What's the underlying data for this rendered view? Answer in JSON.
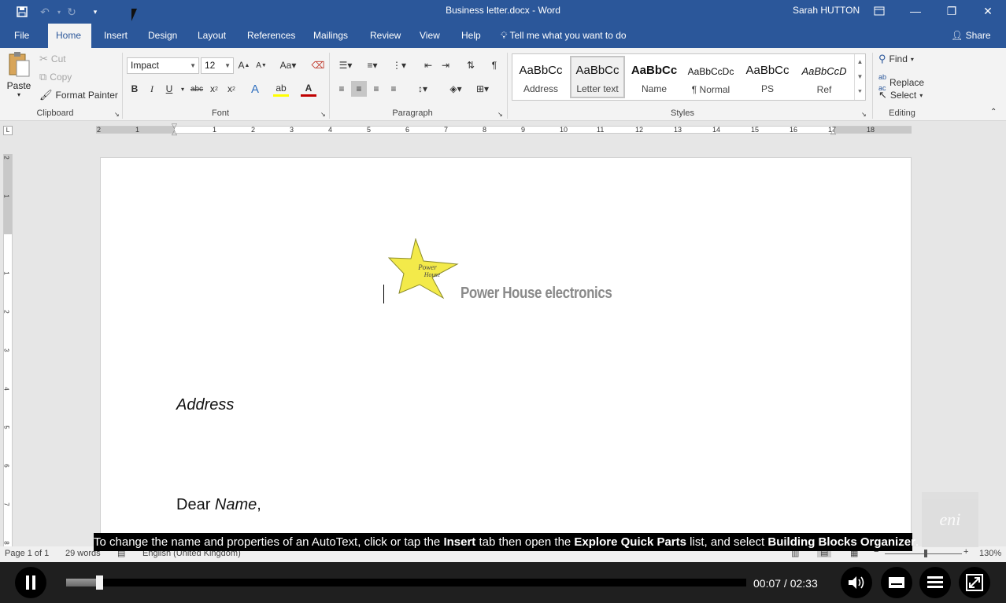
{
  "window": {
    "title": "Business letter.docx  -  Word",
    "user": "Sarah HUTTON"
  },
  "ribbon_tabs": [
    "File",
    "Home",
    "Insert",
    "Design",
    "Layout",
    "References",
    "Mailings",
    "Review",
    "View",
    "Help"
  ],
  "tell_me": "Tell me what you want to do",
  "share": "Share",
  "clipboard": {
    "paste": "Paste",
    "cut": "Cut",
    "copy": "Copy",
    "format_painter": "Format Painter",
    "label": "Clipboard"
  },
  "font": {
    "name": "Impact",
    "size": "12",
    "label": "Font"
  },
  "paragraph": {
    "label": "Paragraph"
  },
  "styles": {
    "label": "Styles",
    "items": [
      {
        "sample": "AaBbCc",
        "name": "Address"
      },
      {
        "sample": "AaBbCc",
        "name": "Letter text"
      },
      {
        "sample": "AaBbCc",
        "name": "Name"
      },
      {
        "sample": "AaBbCcDc",
        "name": "¶ Normal"
      },
      {
        "sample": "AaBbCc",
        "name": "PS"
      },
      {
        "sample": "AaBbCcD",
        "name": "Ref"
      }
    ]
  },
  "editing": {
    "find": "Find",
    "replace": "Replace",
    "select": "Select",
    "label": "Editing"
  },
  "ruler_h": [
    "2",
    "1",
    "1",
    "2",
    "3",
    "4",
    "5",
    "6",
    "7",
    "8",
    "9",
    "10",
    "11",
    "12",
    "13",
    "14",
    "15",
    "16",
    "17",
    "18"
  ],
  "ruler_v": [
    "2",
    "1",
    "1",
    "2",
    "3",
    "4",
    "5",
    "6",
    "7",
    "8"
  ],
  "document": {
    "logo_star_text_1": "Power",
    "logo_star_text_2": "House",
    "company": "Power House electronics",
    "address": "Address",
    "dear_prefix": "Dear ",
    "dear_name": "Name",
    "dear_suffix": ","
  },
  "status": {
    "page": "Page 1 of 1",
    "words": "29 words",
    "language": "English (United Kingdom)",
    "zoom": "130%"
  },
  "caption": {
    "t1": "To change the name and properties of an AutoText, click or tap the ",
    "b1": "Insert",
    "t2": " tab then open the ",
    "b2": "Explore Quick Parts",
    "t3": " list, and select ",
    "b3": "Building Blocks Organizer",
    "t4": "."
  },
  "watermark": "eni",
  "player": {
    "time": "00:07 / 02:33",
    "progress": 0.046
  }
}
